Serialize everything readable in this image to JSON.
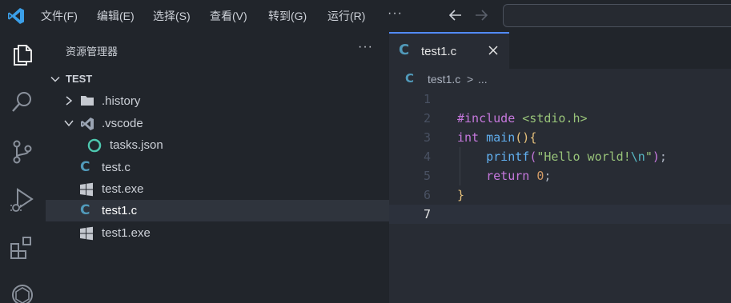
{
  "menu": {
    "file": "文件(F)",
    "edit": "编辑(E)",
    "selection": "选择(S)",
    "view": "查看(V)",
    "goto": "转到(G)",
    "run": "运行(R)",
    "more": "···"
  },
  "sidebar": {
    "title": "资源管理器",
    "more": "···",
    "folder": "TEST",
    "items": [
      {
        "label": ".history",
        "icon": "folder-icon"
      },
      {
        "label": ".vscode",
        "icon": "vscode-folder-icon"
      },
      {
        "label": "tasks.json",
        "icon": "json-icon"
      },
      {
        "label": "test.c",
        "icon": "c-file-icon"
      },
      {
        "label": "test.exe",
        "icon": "windows-icon"
      },
      {
        "label": "test1.c",
        "icon": "c-file-icon"
      },
      {
        "label": "test1.exe",
        "icon": "windows-icon"
      }
    ]
  },
  "editor": {
    "tab_label": "test1.c",
    "tab_icon": "C",
    "breadcrumb_file": "test1.c",
    "breadcrumb_sep": ">",
    "breadcrumb_more": "...",
    "line_numbers": [
      "1",
      "2",
      "3",
      "4",
      "5",
      "6",
      "7"
    ],
    "code": {
      "l2_directive": "#include",
      "l2_header": "<stdio.h>",
      "l3_type": "int",
      "l3_fn": "main",
      "l3_parens": "()",
      "l3_brace": "{",
      "l4_fn": "printf",
      "l4_open": "(",
      "l4_str_a": "\"Hello world!",
      "l4_esc": "\\n",
      "l4_str_b": "\"",
      "l4_close": ")",
      "l4_semi": ";",
      "l5_kw": "return",
      "l5_num": "0",
      "l5_semi": ";",
      "l6_brace": "}"
    }
  },
  "colors": {
    "accent": "#528bff",
    "c_icon": "#519aba",
    "background": "#282c34",
    "sidebar": "#21252b"
  }
}
